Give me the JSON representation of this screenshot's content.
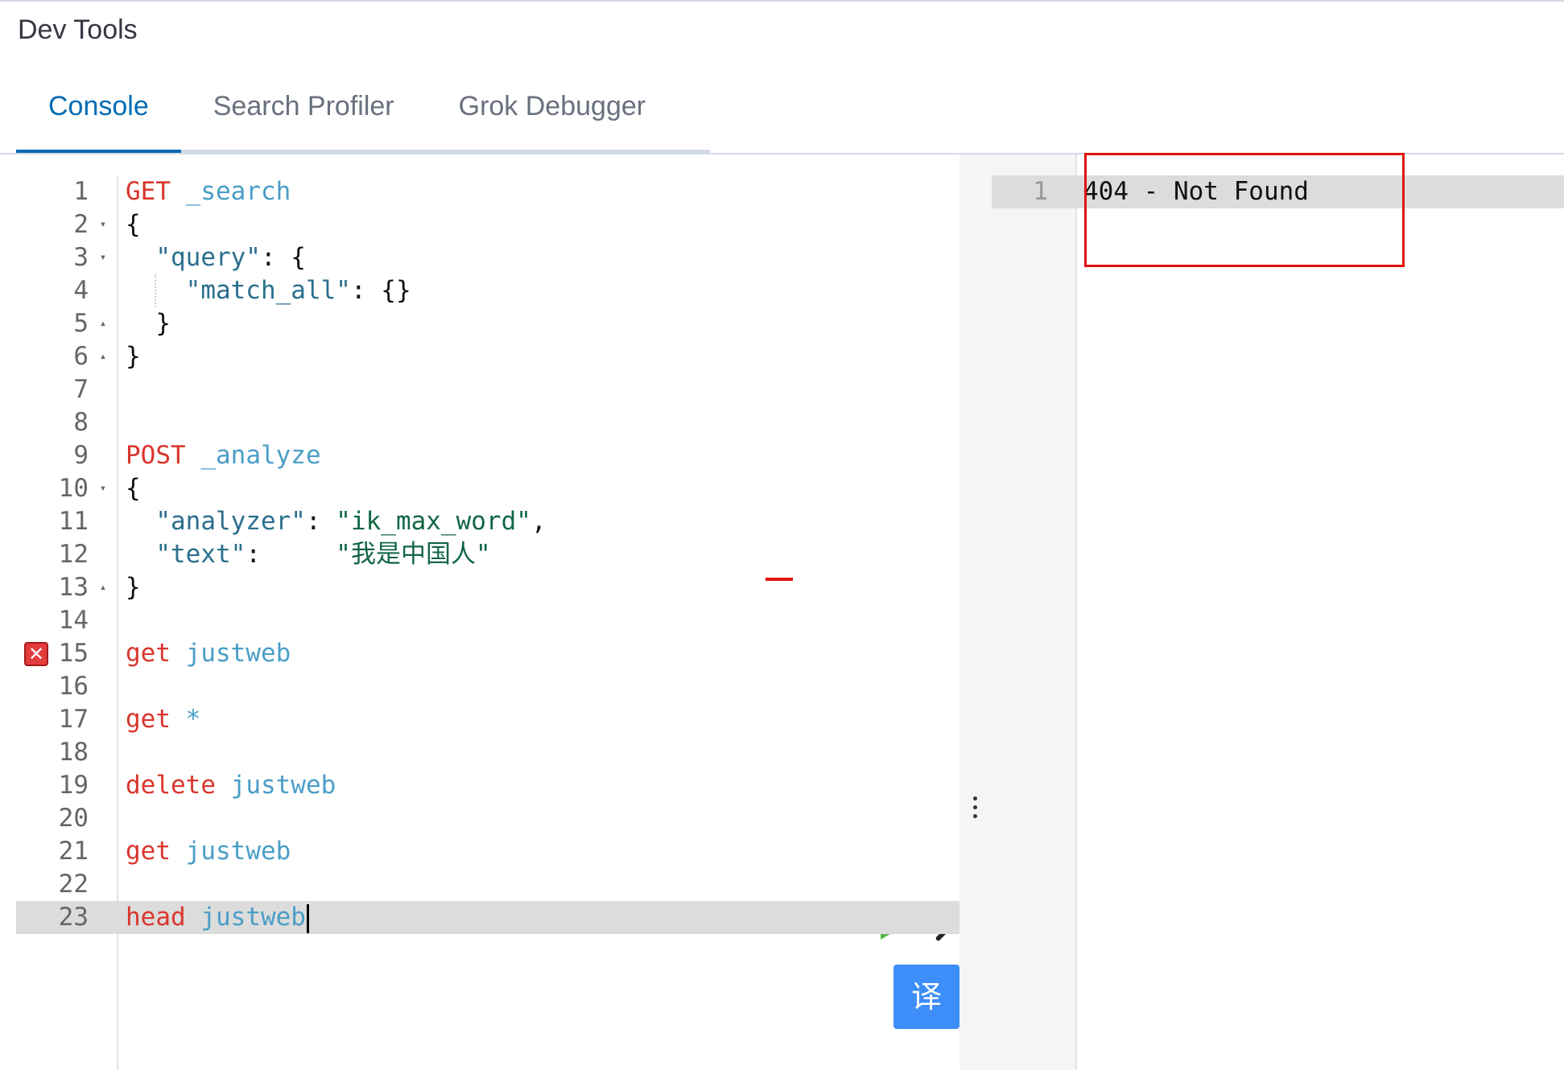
{
  "app": {
    "title": "Dev Tools",
    "tabs": [
      {
        "label": "Console",
        "active": true
      },
      {
        "label": "Search Profiler",
        "active": false
      },
      {
        "label": "Grok Debugger",
        "active": false
      }
    ]
  },
  "editor": {
    "lines": [
      {
        "n": "1",
        "parts": [
          [
            "method",
            "GET"
          ],
          [
            "punc",
            " "
          ],
          [
            "url",
            "_search"
          ]
        ]
      },
      {
        "n": "2",
        "fold": "down",
        "parts": [
          [
            "punc",
            "{"
          ]
        ]
      },
      {
        "n": "3",
        "fold": "down",
        "parts": [
          [
            "punc",
            "  "
          ],
          [
            "str",
            "\"query\""
          ],
          [
            "punc",
            ": {"
          ]
        ]
      },
      {
        "n": "4",
        "guide": true,
        "parts": [
          [
            "punc",
            "    "
          ],
          [
            "str",
            "\"match_all\""
          ],
          [
            "punc",
            ": {}"
          ]
        ]
      },
      {
        "n": "5",
        "fold": "up",
        "parts": [
          [
            "punc",
            "  }"
          ]
        ]
      },
      {
        "n": "6",
        "fold": "up",
        "parts": [
          [
            "punc",
            "}"
          ]
        ]
      },
      {
        "n": "7",
        "parts": []
      },
      {
        "n": "8",
        "parts": []
      },
      {
        "n": "9",
        "parts": [
          [
            "method",
            "POST"
          ],
          [
            "punc",
            " "
          ],
          [
            "url",
            "_analyze"
          ]
        ]
      },
      {
        "n": "10",
        "fold": "down",
        "parts": [
          [
            "punc",
            "{"
          ]
        ]
      },
      {
        "n": "11",
        "parts": [
          [
            "punc",
            "  "
          ],
          [
            "str",
            "\"analyzer\""
          ],
          [
            "punc",
            ": "
          ],
          [
            "strval",
            "\"ik_max_word\""
          ],
          [
            "punc",
            ","
          ]
        ]
      },
      {
        "n": "12",
        "parts": [
          [
            "punc",
            "  "
          ],
          [
            "str",
            "\"text\""
          ],
          [
            "punc",
            ":     "
          ],
          [
            "strval",
            "\"我是中国人\""
          ]
        ]
      },
      {
        "n": "13",
        "fold": "up",
        "parts": [
          [
            "punc",
            "}"
          ]
        ]
      },
      {
        "n": "14",
        "parts": []
      },
      {
        "n": "15",
        "error": true,
        "parts": [
          [
            "method",
            "get"
          ],
          [
            "punc",
            " "
          ],
          [
            "url",
            "justweb"
          ]
        ]
      },
      {
        "n": "16",
        "parts": []
      },
      {
        "n": "17",
        "parts": [
          [
            "method",
            "get"
          ],
          [
            "punc",
            " "
          ],
          [
            "url",
            "*"
          ]
        ]
      },
      {
        "n": "18",
        "parts": []
      },
      {
        "n": "19",
        "parts": [
          [
            "method",
            "delete"
          ],
          [
            "punc",
            " "
          ],
          [
            "url",
            "justweb"
          ]
        ]
      },
      {
        "n": "20",
        "parts": []
      },
      {
        "n": "21",
        "parts": [
          [
            "method",
            "get"
          ],
          [
            "punc",
            " "
          ],
          [
            "url",
            "justweb"
          ]
        ]
      },
      {
        "n": "22",
        "parts": []
      },
      {
        "n": "23",
        "current": true,
        "cursor": true,
        "parts": [
          [
            "method",
            "head"
          ],
          [
            "punc",
            " "
          ],
          [
            "url",
            "justweb"
          ]
        ]
      }
    ],
    "run_icon": "play-icon",
    "settings_icon": "wrench-icon",
    "translate_label": "译"
  },
  "output": {
    "lines": [
      {
        "n": "1",
        "text": "404 - Not Found"
      }
    ]
  },
  "colors": {
    "accent": "#006bb4",
    "method": "#d9362d",
    "url": "#4a9ec7",
    "run": "#54b948",
    "translate": "#3d8ef8",
    "annotation": "#e01010"
  }
}
